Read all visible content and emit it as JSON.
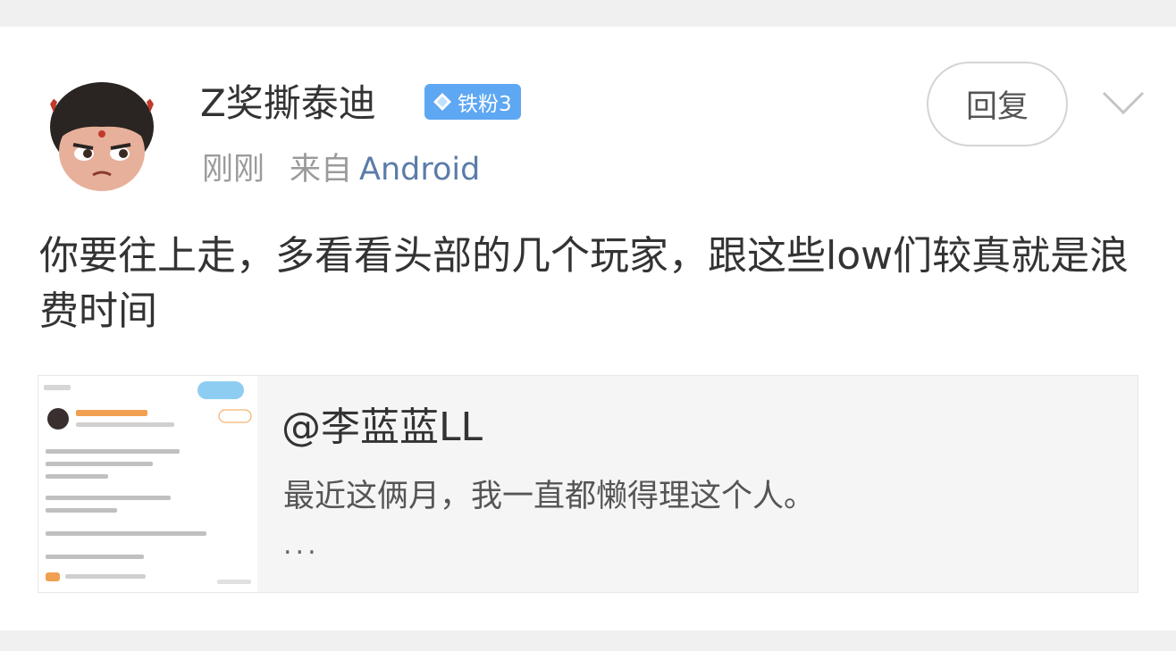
{
  "comment": {
    "username": "Z奖撕泰迪",
    "badge": "铁粉3",
    "time": "刚刚",
    "from_label": "来自",
    "device": "Android",
    "reply_label": "回复",
    "text": "你要往上走，多看看头部的几个玩家，跟这些low们较真就是浪费时间"
  },
  "quote": {
    "author": "@李蓝蓝LL",
    "text": "最近这俩月，我一直都懒得理这个人。",
    "ellipsis": "..."
  },
  "icons": {
    "avatar": "cartoon-avatar",
    "badge": "diamond-icon",
    "more": "chevron-down-icon"
  },
  "colors": {
    "badge": "#5ea7f2",
    "device_link": "#5b7ca8"
  }
}
